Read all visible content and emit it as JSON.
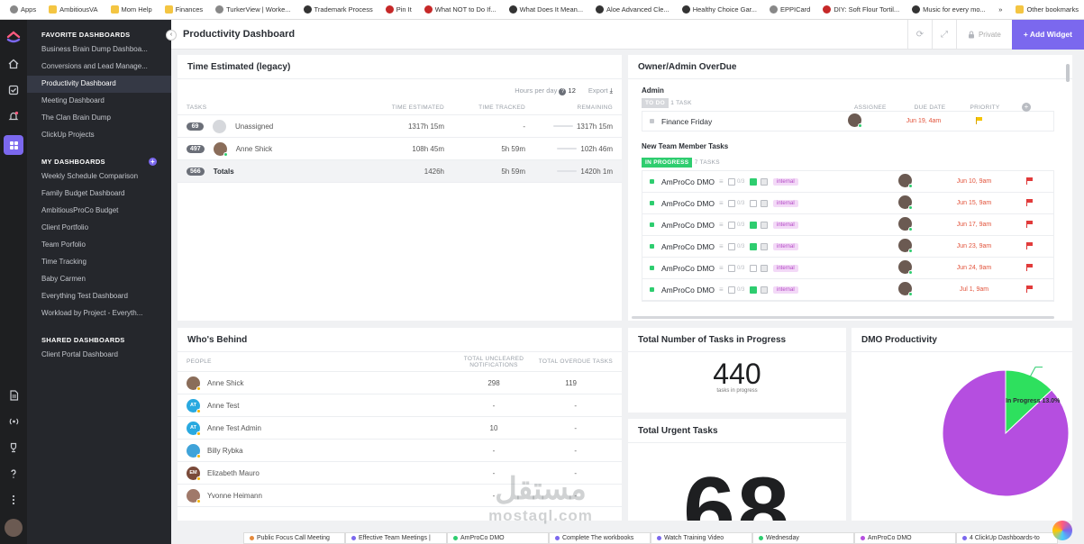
{
  "bookmarks": {
    "items": [
      "Apps",
      "AmbitiousVA",
      "Mom Help",
      "Finances",
      "TurkerView | Worke...",
      "Trademark Process",
      "Pin It",
      "What NOT to Do If...",
      "What Does It Mean...",
      "Aloe Advanced Cle...",
      "Healthy Choice Gar...",
      "EPPICard",
      "DIY: Soft Flour Tortil...",
      "Music for every mo..."
    ],
    "more": "»",
    "other": "Other bookmarks"
  },
  "sidebar": {
    "favorites_title": "FAVORITE DASHBOARDS",
    "favorites": [
      "Business Brain Dump Dashboa...",
      "Conversions and Lead Manage...",
      "Productivity Dashboard",
      "Meeting Dashboard",
      "The Clan Brain Dump",
      "ClickUp Projects"
    ],
    "my_title": "MY DASHBOARDS",
    "my": [
      "Weekly Schedule Comparison",
      "Family Budget Dashboard",
      "AmbitiousProCo Budget",
      "Client Portfolio",
      "Team Porfolio",
      "Time Tracking",
      "Baby Carmen",
      "Everything Test Dashboard",
      "Workload by Project - Everyth..."
    ],
    "shared_title": "SHARED DASHBOARDS",
    "shared": [
      "Client Portal Dashboard"
    ],
    "plus": "+"
  },
  "topbar": {
    "title": "Productivity Dashboard",
    "private": "Private",
    "add_widget": "+ Add Widget"
  },
  "time_estimated": {
    "title": "Time Estimated (legacy)",
    "hours_label": "Hours per day",
    "hours_value": "12",
    "export": "Export",
    "headers": [
      "TASKS",
      "TIME ESTIMATED",
      "TIME TRACKED",
      "REMAINING"
    ],
    "rows": [
      {
        "count": "69",
        "name": "Unassigned",
        "estimated": "1317h 15m",
        "tracked": "-",
        "remaining": "1317h 15m"
      },
      {
        "count": "497",
        "name": "Anne Shick",
        "estimated": "108h 45m",
        "tracked": "5h 59m",
        "remaining": "102h 46m"
      },
      {
        "count": "566",
        "name": "Totals",
        "estimated": "1426h",
        "tracked": "5h 59m",
        "remaining": "1420h 1m"
      }
    ]
  },
  "overdue": {
    "title": "Owner/Admin OverDue",
    "group1": "Admin",
    "headers": [
      "ASSIGNEE",
      "DUE DATE",
      "PRIORITY"
    ],
    "todo_status": "TO DO",
    "todo_count": "1 TASK",
    "todo_tasks": [
      {
        "name": "Finance Friday",
        "due": "Jun 19, 4am"
      }
    ],
    "group2": "New Team Member Tasks",
    "ip_status": "IN PROGRESS",
    "ip_count": "7 TASKS",
    "subtasks": "0/3",
    "tag": "internal",
    "ip_tasks": [
      {
        "name": "AmProCo DMO",
        "due": "Jun 10, 9am"
      },
      {
        "name": "AmProCo DMO",
        "due": "Jun 15, 9am"
      },
      {
        "name": "AmProCo DMO",
        "due": "Jun 17, 9am"
      },
      {
        "name": "AmProCo DMO",
        "due": "Jun 23, 9am"
      },
      {
        "name": "AmProCo DMO",
        "due": "Jun 24, 9am"
      },
      {
        "name": "AmProCo DMO",
        "due": "Jul 1, 9am"
      }
    ]
  },
  "whos_behind": {
    "title": "Who's Behind",
    "headers": [
      "PEOPLE",
      "TOTAL UNCLEARED NOTIFICATIONS",
      "TOTAL OVERDUE TASKS"
    ],
    "rows": [
      {
        "name": "Anne Shick",
        "initials": "",
        "notif": "298",
        "overdue": "119",
        "color": "#8a6d5a"
      },
      {
        "name": "Anne Test",
        "initials": "AT",
        "notif": "-",
        "overdue": "-",
        "color": "#29a9e0"
      },
      {
        "name": "Anne Test Admin",
        "initials": "AT",
        "notif": "10",
        "overdue": "-",
        "color": "#29a9e0"
      },
      {
        "name": "Billy Rybka",
        "initials": "",
        "notif": "-",
        "overdue": "-",
        "color": "#3fa3d9"
      },
      {
        "name": "Elizabeth Mauro",
        "initials": "EM",
        "notif": "-",
        "overdue": "-",
        "color": "#7a4a3a"
      },
      {
        "name": "Yvonne Heimann",
        "initials": "",
        "notif": "-",
        "overdue": "-",
        "color": "#a0796a"
      }
    ]
  },
  "in_progress": {
    "title": "Total Number of Tasks in Progress",
    "value": "440",
    "caption": "tasks in progress"
  },
  "urgent": {
    "title": "Total Urgent Tasks",
    "value": "68"
  },
  "dmo": {
    "title": "DMO Productivity",
    "label": "In Progress 13.0%"
  },
  "chart_data": {
    "type": "pie",
    "title": "DMO Productivity",
    "slices": [
      {
        "label": "In Progress",
        "value": 13.0,
        "color": "#2ee05e"
      },
      {
        "label": "",
        "value": 87.0,
        "color": "#b54ee0"
      }
    ]
  },
  "watermark": {
    "arabic": "مستقل",
    "latin": "mostaql.com"
  },
  "taskbar": [
    "Public Focus Call Meeting",
    "Effective Team Meetings |",
    "AmProCo DMO",
    "Complete The workbooks",
    "Watch Training Video",
    "Wednesday",
    "AmProCo DMO",
    "4 ClickUp Dashboards-to"
  ]
}
